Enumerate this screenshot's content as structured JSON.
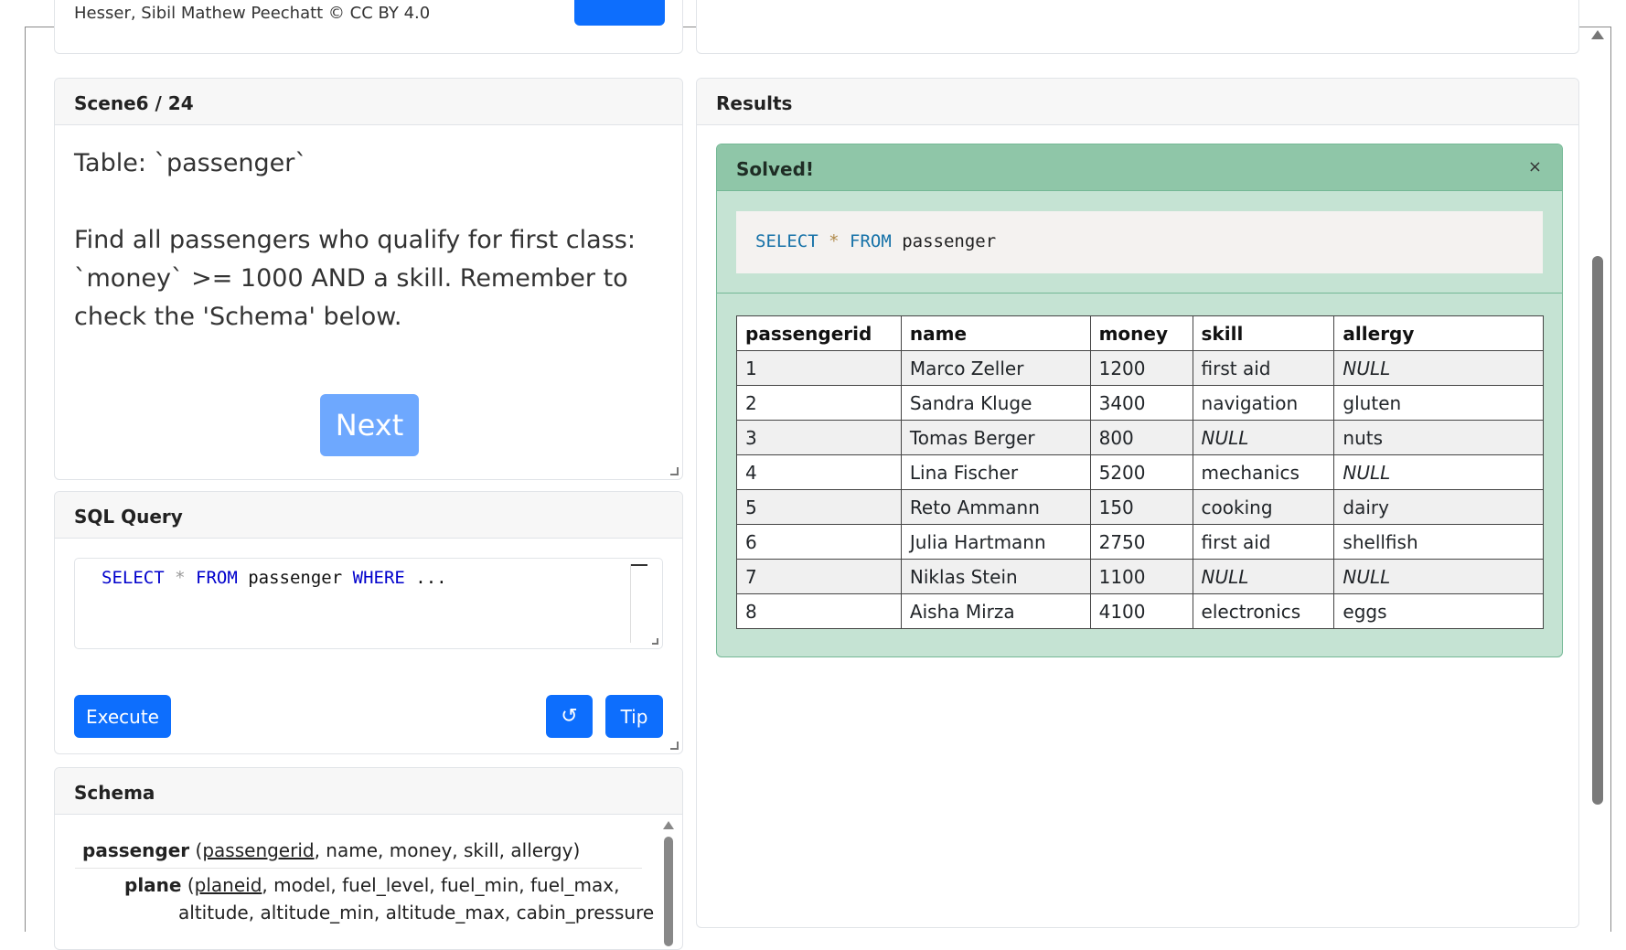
{
  "top": {
    "credit_text": "Hesser, Sibil Mathew Peechatt © CC BY 4.0"
  },
  "scene": {
    "title": "Scene6 / 24",
    "task": "Table: `passenger`\n\nFind all passengers who qualify for first class: `money` >= 1000 AND a skill. Remember to check the 'Schema' below.",
    "next_label": "Next"
  },
  "sql": {
    "title": "SQL Query",
    "code": {
      "kw1": "SELECT",
      "star": "*",
      "kw2": "FROM",
      "table": "passenger",
      "kw3": "WHERE",
      "rest": "..."
    },
    "execute_label": "Execute",
    "reset_label": "↺",
    "tip_label": "Tip"
  },
  "schema": {
    "title": "Schema",
    "rows": [
      {
        "table": "passenger",
        "pk": "passengerid",
        "cols": ", name, money, skill, allergy)"
      },
      {
        "table": "plane",
        "pk": "planeid",
        "cols": ", model, fuel_level, fuel_min, fuel_max,"
      }
    ],
    "continuation": "altitude, altitude_min, altitude_max, cabin_pressure"
  },
  "results": {
    "title": "Results",
    "alert_title": "Solved!",
    "close": "×",
    "query": {
      "kw1": "SELECT",
      "star": "*",
      "kw2": "FROM",
      "table": "passenger"
    },
    "columns": [
      "passengerid",
      "name",
      "money",
      "skill",
      "allergy"
    ],
    "rows": [
      [
        "1",
        "Marco Zeller",
        "1200",
        "first aid",
        "NULL"
      ],
      [
        "2",
        "Sandra Kluge",
        "3400",
        "navigation",
        "gluten"
      ],
      [
        "3",
        "Tomas Berger",
        "800",
        "NULL",
        "nuts"
      ],
      [
        "4",
        "Lina Fischer",
        "5200",
        "mechanics",
        "NULL"
      ],
      [
        "5",
        "Reto Ammann",
        "150",
        "cooking",
        "dairy"
      ],
      [
        "6",
        "Julia Hartmann",
        "2750",
        "first aid",
        "shellfish"
      ],
      [
        "7",
        "Niklas Stein",
        "1100",
        "NULL",
        "NULL"
      ],
      [
        "8",
        "Aisha Mirza",
        "4100",
        "electronics",
        "eggs"
      ]
    ]
  }
}
